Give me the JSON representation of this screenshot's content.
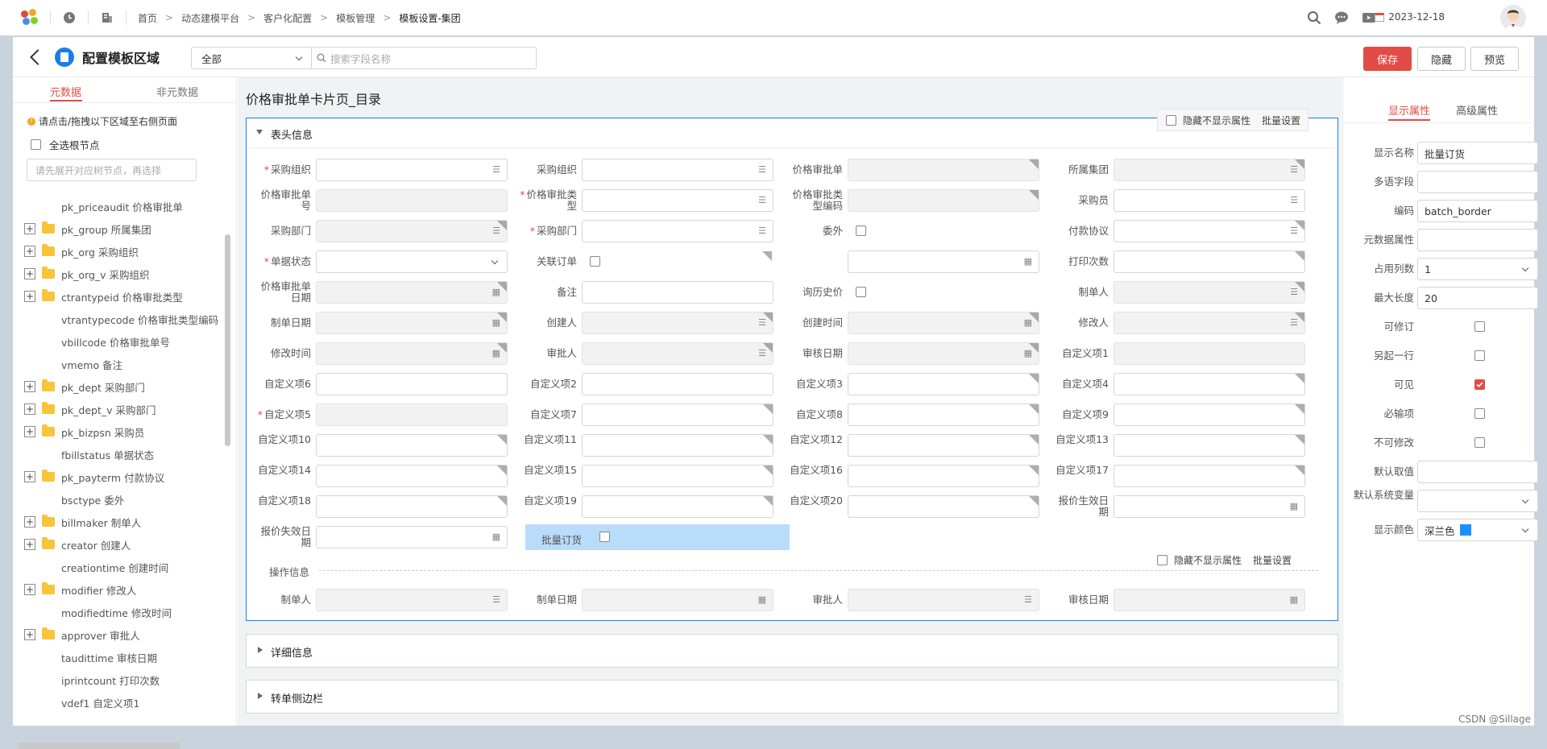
{
  "breadcrumb": [
    "首页",
    "动态建模平台",
    "客户化配置",
    "模板管理",
    "模板设置-集团"
  ],
  "date": "2023-12-18",
  "header": {
    "title": "配置模板区域",
    "filter_value": "全部",
    "search_placeholder": "搜索字段名称",
    "save": "保存",
    "hide": "隐藏",
    "preview": "预览"
  },
  "left": {
    "tab_meta": "元数据",
    "tab_nonmeta": "非元数据",
    "hint": "请点击/拖拽以下区域至右侧页面",
    "select_all": "全选根节点",
    "search_placeholder": "请先展开对应树节点，再选择",
    "items": [
      {
        "label": "pk_priceaudit 价格审批单",
        "expand": false
      },
      {
        "label": "pk_group 所属集团",
        "expand": true
      },
      {
        "label": "pk_org 采购组织",
        "expand": true
      },
      {
        "label": "pk_org_v 采购组织",
        "expand": true
      },
      {
        "label": "ctrantypeid 价格审批类型",
        "expand": true
      },
      {
        "label": "vtrantypecode 价格审批类型编码",
        "expand": false
      },
      {
        "label": "vbillcode 价格审批单号",
        "expand": false
      },
      {
        "label": "vmemo 备注",
        "expand": false
      },
      {
        "label": "pk_dept 采购部门",
        "expand": true
      },
      {
        "label": "pk_dept_v 采购部门",
        "expand": true
      },
      {
        "label": "pk_bizpsn 采购员",
        "expand": true
      },
      {
        "label": "fbillstatus 单据状态",
        "expand": false
      },
      {
        "label": "pk_payterm 付款协议",
        "expand": true
      },
      {
        "label": "bsctype 委外",
        "expand": false
      },
      {
        "label": "billmaker 制单人",
        "expand": true
      },
      {
        "label": "creator 创建人",
        "expand": true
      },
      {
        "label": "creationtime 创建时间",
        "expand": false
      },
      {
        "label": "modifier 修改人",
        "expand": true
      },
      {
        "label": "modifiedtime 修改时间",
        "expand": false
      },
      {
        "label": "approver 审批人",
        "expand": true
      },
      {
        "label": "taudittime 审核日期",
        "expand": false
      },
      {
        "label": "iprintcount 打印次数",
        "expand": false
      },
      {
        "label": "vdef1 自定义项1",
        "expand": false
      }
    ]
  },
  "mid": {
    "page_title": "价格审批单卡片页_目录",
    "hide_attr": "隐藏不显示属性",
    "batch": "批量设置",
    "section_head": "表头信息",
    "section_ops": "操作信息",
    "section_detail": "详细信息",
    "section_side": "转单侧边栏"
  },
  "rows": [
    [
      {
        "l": "采购组织",
        "r": 1,
        "t": "ref"
      },
      {
        "l": "采购组织",
        "t": "ref"
      },
      {
        "l": "价格审批单",
        "t": "dis",
        "c": 1
      },
      {
        "l": "所属集团",
        "t": "disref",
        "c": 1
      }
    ],
    [
      {
        "l": "价格审批单号",
        "t": "dis",
        "c": 0
      },
      {
        "l": "价格审批类型",
        "r": 1,
        "t": "ref"
      },
      {
        "l": "价格审批类型编码",
        "t": "dis",
        "c": 1
      },
      {
        "l": "采购员",
        "t": "ref"
      }
    ],
    [
      {
        "l": "采购部门",
        "t": "disref",
        "c": 1
      },
      {
        "l": "采购部门",
        "r": 1,
        "t": "ref"
      },
      {
        "l": "委外",
        "t": "chk"
      },
      {
        "l": "付款协议",
        "t": "ref",
        "c": 1
      }
    ],
    [
      {
        "l": "单据状态",
        "r": 1,
        "t": "sel"
      },
      {
        "l": "关联订单",
        "t": "chk",
        "c": 1
      },
      {
        "l": "",
        "t": "date"
      },
      {
        "l": "打印次数",
        "t": "txt",
        "c": 1
      }
    ],
    [
      {
        "l": "价格审批单日期",
        "t": "disdate",
        "c": 1
      },
      {
        "l": "备注",
        "t": "txt"
      },
      {
        "l": "询历史价",
        "t": "chk"
      },
      {
        "l": "制单人",
        "t": "disref",
        "c": 1
      }
    ],
    [
      {
        "l": "制单日期",
        "t": "disdate",
        "c": 1
      },
      {
        "l": "创建人",
        "t": "disref",
        "c": 1
      },
      {
        "l": "创建时间",
        "t": "disdate",
        "c": 1
      },
      {
        "l": "修改人",
        "t": "disref",
        "c": 1
      }
    ],
    [
      {
        "l": "修改时间",
        "t": "disdate",
        "c": 1
      },
      {
        "l": "审批人",
        "t": "disref",
        "c": 1
      },
      {
        "l": "审核日期",
        "t": "disdate",
        "c": 1
      },
      {
        "l": "自定义项1",
        "t": "dis"
      }
    ],
    [
      {
        "l": "自定义项6",
        "t": "txt"
      },
      {
        "l": "自定义项2",
        "t": "txt"
      },
      {
        "l": "自定义项3",
        "t": "txt",
        "c": 1
      },
      {
        "l": "自定义项4",
        "t": "txt",
        "c": 1
      }
    ],
    [
      {
        "l": "自定义项5",
        "r": 1,
        "t": "dis"
      },
      {
        "l": "自定义项7",
        "t": "txt",
        "c": 1
      },
      {
        "l": "自定义项8",
        "t": "txt",
        "c": 1
      },
      {
        "l": "自定义项9",
        "t": "txt",
        "c": 1
      }
    ],
    [
      {
        "l": "自定义项10",
        "t": "txt",
        "c": 1
      },
      {
        "l": "自定义项11",
        "t": "txt",
        "c": 1
      },
      {
        "l": "自定义项12",
        "t": "txt",
        "c": 1
      },
      {
        "l": "自定义项13",
        "t": "txt",
        "c": 1
      }
    ],
    [
      {
        "l": "自定义项14",
        "t": "txt",
        "c": 1
      },
      {
        "l": "自定义项15",
        "t": "txt",
        "c": 1
      },
      {
        "l": "自定义项16",
        "t": "txt",
        "c": 1
      },
      {
        "l": "自定义项17",
        "t": "txt",
        "c": 1
      }
    ],
    [
      {
        "l": "自定义项18",
        "t": "txt",
        "c": 1
      },
      {
        "l": "自定义项19",
        "t": "txt",
        "c": 1
      },
      {
        "l": "自定义项20",
        "t": "txt",
        "c": 1
      },
      {
        "l": "报价生效日期",
        "t": "date"
      }
    ],
    [
      {
        "l": "报价失效日期",
        "t": "date"
      },
      {
        "l": "批量订货",
        "t": "chksel"
      }
    ]
  ],
  "ops_row": [
    {
      "l": "制单人",
      "t": "disref"
    },
    {
      "l": "制单日期",
      "t": "disdate"
    },
    {
      "l": "审批人",
      "t": "disref"
    },
    {
      "l": "审核日期",
      "t": "disdate"
    }
  ],
  "right": {
    "tab_display": "显示属性",
    "tab_advanced": "高级属性",
    "props": [
      {
        "l": "显示名称",
        "v": "批量订货",
        "t": "in"
      },
      {
        "l": "多语字段",
        "v": "",
        "t": "in"
      },
      {
        "l": "编码",
        "v": "batch_border",
        "t": "in"
      },
      {
        "l": "元数据属性",
        "v": "",
        "t": "in"
      },
      {
        "l": "占用列数",
        "v": "1",
        "t": "sel"
      },
      {
        "l": "最大长度",
        "v": "20",
        "t": "in"
      },
      {
        "l": "可修订",
        "v": false,
        "t": "chk"
      },
      {
        "l": "另起一行",
        "v": false,
        "t": "chk"
      },
      {
        "l": "可见",
        "v": true,
        "t": "chk"
      },
      {
        "l": "必输项",
        "v": false,
        "t": "chk"
      },
      {
        "l": "不可修改",
        "v": false,
        "t": "chk"
      },
      {
        "l": "默认取值",
        "v": "",
        "t": "in"
      },
      {
        "l": "默认系统变量",
        "v": "",
        "t": "sel"
      },
      {
        "l": "显示颜色",
        "v": "深兰色",
        "t": "color"
      }
    ],
    "color_swatch": "#1890ff"
  },
  "watermark": "CSDN @Sillage"
}
